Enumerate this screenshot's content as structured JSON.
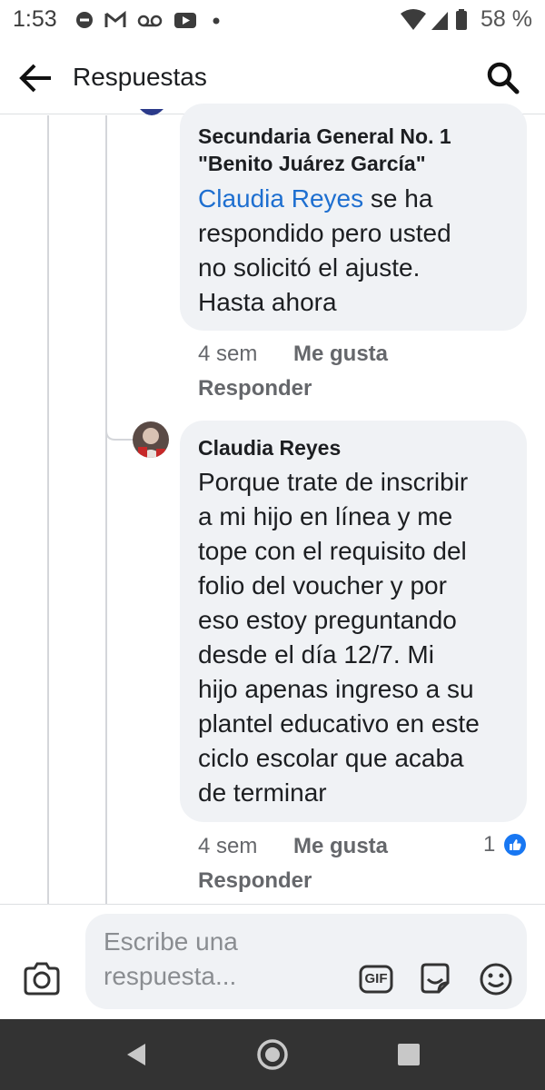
{
  "status_bar": {
    "time": "1:53",
    "battery": "58 %"
  },
  "header": {
    "title": "Respuestas",
    "back_icon": "arrow-left-icon",
    "search_icon": "search-icon"
  },
  "comments": [
    {
      "author_line1": "Secundaria General No. 1",
      "author_line2": "\"Benito Juárez García\"",
      "mention": "Claudia Reyes",
      "lines": [
        " se ha",
        "respondido pero usted",
        "no solicitó el ajuste.",
        "Hasta ahora"
      ],
      "time": "4 sem",
      "like": "Me gusta",
      "reply": "Responder"
    },
    {
      "author": "Claudia Reyes",
      "lines": [
        "Porque trate de inscribir",
        "a mi hijo en línea y me",
        "tope con el requisito del",
        "folio del voucher y por",
        "eso estoy preguntando",
        "desde el día 12/7. Mi",
        "hijo apenas ingreso a su",
        "plantel educativo en este",
        "ciclo escolar que acaba",
        "de terminar"
      ],
      "time": "4 sem",
      "like": "Me gusta",
      "reply": "Responder",
      "reaction_count": "1"
    }
  ],
  "composer": {
    "placeholder_line1": "Escribe una",
    "placeholder_line2": "respuesta...",
    "gif_label": "GIF"
  },
  "colors": {
    "mention": "#1e6fd0",
    "like_blue": "#1877f2",
    "bubble": "#f0f2f5"
  }
}
